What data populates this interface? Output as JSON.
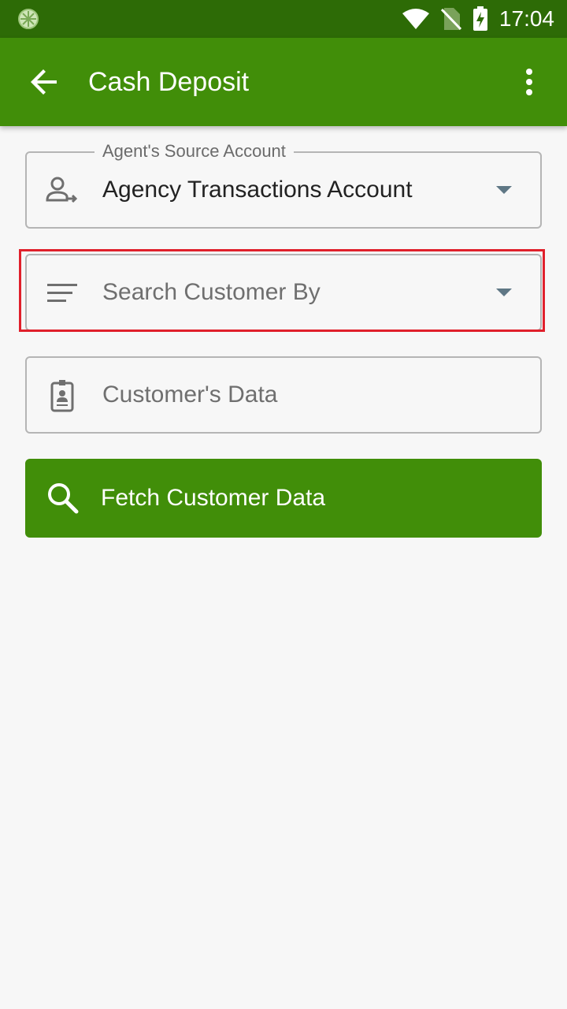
{
  "status_bar": {
    "time": "17:04",
    "icons": [
      "app-notification-icon",
      "wifi-icon",
      "no-sim-icon",
      "battery-charging-icon"
    ]
  },
  "app_bar": {
    "title": "Cash Deposit",
    "back_icon": "arrow-back-icon",
    "menu_icon": "more-vert-icon",
    "color": "#418e09"
  },
  "form": {
    "source_account": {
      "label": "Agent's Source Account",
      "value": "Agency Transactions Account",
      "icon": "person-transfer-icon"
    },
    "search_by": {
      "placeholder": "Search Customer By",
      "icon": "filter-list-icon"
    },
    "customer_data": {
      "placeholder": "Customer's Data",
      "icon": "id-badge-icon"
    },
    "fetch_button": {
      "label": "Fetch Customer Data",
      "icon": "search-icon"
    }
  },
  "colors": {
    "status_bar": "#2d6b06",
    "primary": "#418e09",
    "highlight": "#e0202b",
    "background": "#f7f7f7"
  }
}
